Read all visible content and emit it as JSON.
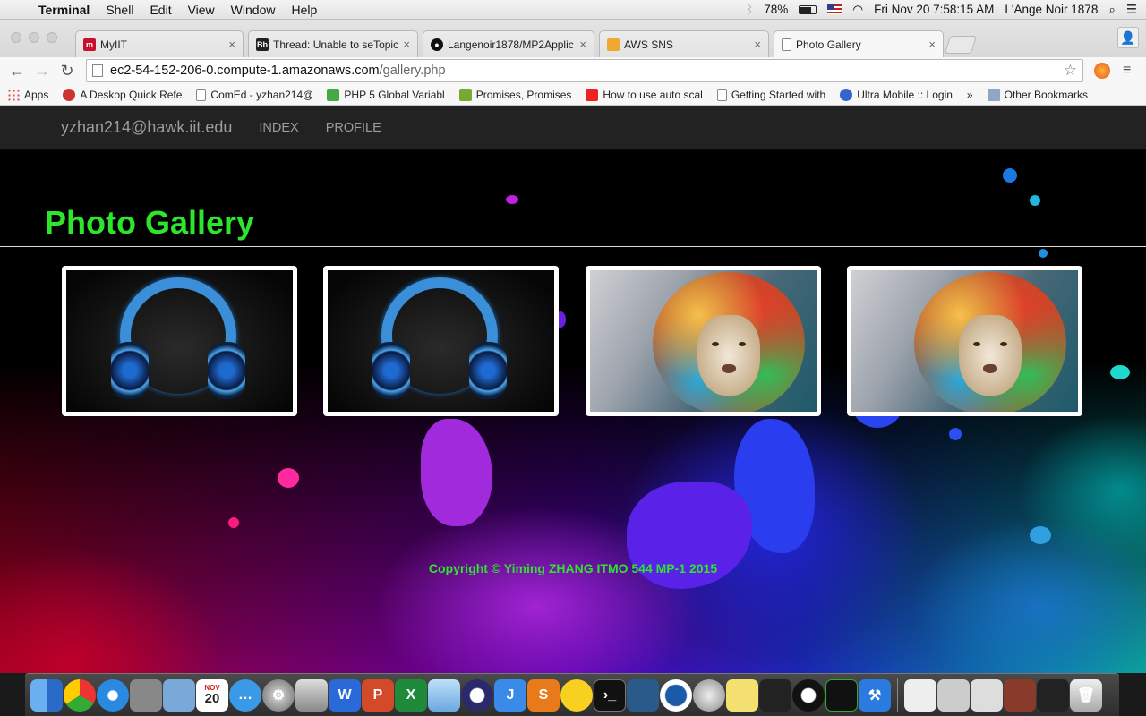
{
  "menubar": {
    "app_name": "Terminal",
    "menus": [
      "Shell",
      "Edit",
      "View",
      "Window",
      "Help"
    ],
    "battery": "78%",
    "datetime": "Fri Nov 20  7:58:15 AM",
    "user": "L'Ange Noir 1878"
  },
  "browser": {
    "tabs": [
      {
        "title": "MyIIT",
        "icon": "myiit-icon"
      },
      {
        "title": "Thread: Unable to seTopicA",
        "icon": "blackboard-icon"
      },
      {
        "title": "Langenoir1878/MP2Applic",
        "icon": "github-icon"
      },
      {
        "title": "AWS SNS",
        "icon": "aws-icon"
      },
      {
        "title": "Photo Gallery",
        "icon": "page-icon"
      }
    ],
    "url_domain": "ec2-54-152-206-0.compute-1.amazonaws.com",
    "url_path": "/gallery.php",
    "bookmarks": [
      "Apps",
      "A Deskop Quick Refe",
      "ComEd - yzhan214@",
      "PHP 5 Global Variabl",
      "Promises, Promises",
      "How to use auto scal",
      "Getting Started with",
      "Ultra Mobile :: Login"
    ],
    "bookmarks_more": "»",
    "other_bookmarks": "Other Bookmarks"
  },
  "site": {
    "brand": "yzhan214@hawk.iit.edu",
    "nav": [
      "INDEX",
      "PROFILE"
    ],
    "heading": "Photo Gallery",
    "photos": [
      "headphones",
      "headphones",
      "lion",
      "lion"
    ],
    "footer": "Copyright © Yiming ZHANG ITMO 544 MP-1 2015",
    "accent_color": "#2ee52e"
  },
  "dock": {
    "calendar_month": "NOV",
    "calendar_day": "20"
  }
}
